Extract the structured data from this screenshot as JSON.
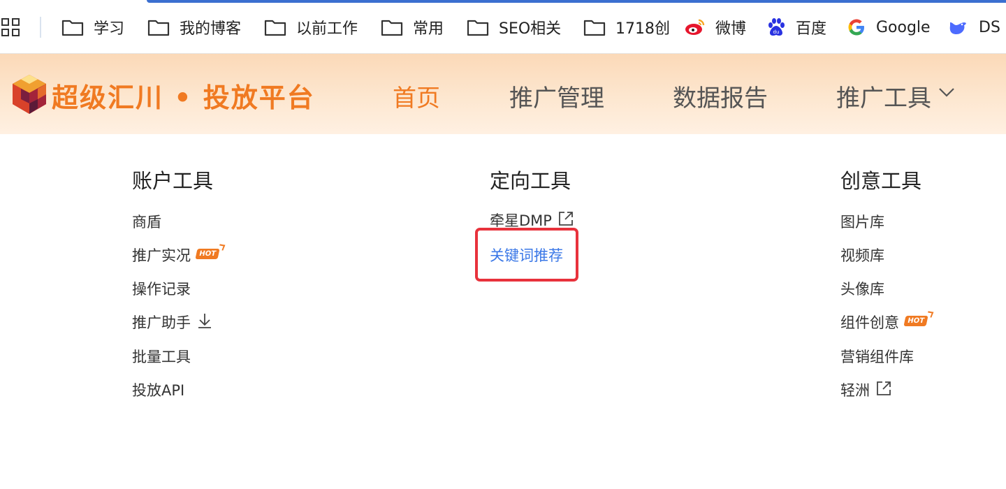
{
  "bookmarks": [
    {
      "label": "学习",
      "icon": "folder-icon"
    },
    {
      "label": "我的博客",
      "icon": "folder-icon"
    },
    {
      "label": "以前工作",
      "icon": "folder-icon"
    },
    {
      "label": "常用",
      "icon": "folder-icon"
    },
    {
      "label": "SEO相关",
      "icon": "folder-icon"
    },
    {
      "label": "1718创",
      "icon": "folder-icon"
    },
    {
      "label": "微博",
      "icon": "weibo-icon"
    },
    {
      "label": "百度",
      "icon": "baidu-icon"
    },
    {
      "label": "Google",
      "icon": "google-icon"
    },
    {
      "label": "DS",
      "icon": "deepseek-icon"
    }
  ],
  "header": {
    "brand": "超级汇川 • 投放平台",
    "nav": [
      "首页",
      "推广管理",
      "数据报告",
      "推广工具"
    ]
  },
  "menu": {
    "account": {
      "title": "账户工具",
      "items": [
        "商盾",
        "推广实况",
        "操作记录",
        "推广助手",
        "批量工具",
        "投放API"
      ]
    },
    "targeting": {
      "title": "定向工具",
      "items": [
        "牵星DMP",
        "关键词推荐"
      ]
    },
    "creative": {
      "title": "创意工具",
      "items": [
        "图片库",
        "视频库",
        "头像库",
        "组件创意",
        "营销组件库",
        "轻洲"
      ]
    },
    "badge": "HOT"
  },
  "colors": {
    "accent": "#f07a22",
    "link_active": "#3b78e7",
    "highlight": "#e8323c"
  }
}
